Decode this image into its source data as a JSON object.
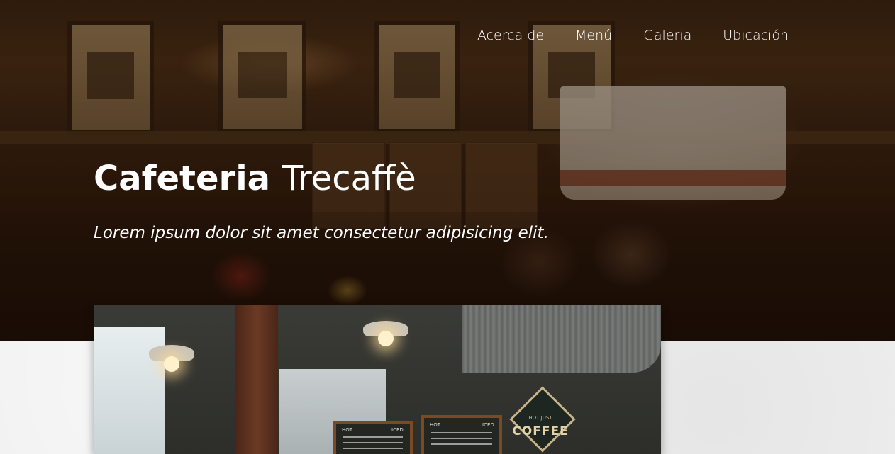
{
  "nav": {
    "items": [
      {
        "label": "Acerca de"
      },
      {
        "label": "Menú"
      },
      {
        "label": "Galeria"
      },
      {
        "label": "Ubicación"
      }
    ]
  },
  "hero": {
    "title_bold": "Cafeteria",
    "title_light": "Trecaffè",
    "tagline": "Lorem ipsum dolor sit amet consectetur adipisicing elit."
  },
  "feature_image": {
    "sign_top": "HOT JUST",
    "sign_text": "COFFEE",
    "board_left_label": "HOT",
    "board_left_label2": "ICED",
    "board_right_label": "HOT",
    "board_right_label2": "ICED"
  },
  "colors": {
    "hero_text": "#ffffff",
    "page_background": "#efefef"
  }
}
